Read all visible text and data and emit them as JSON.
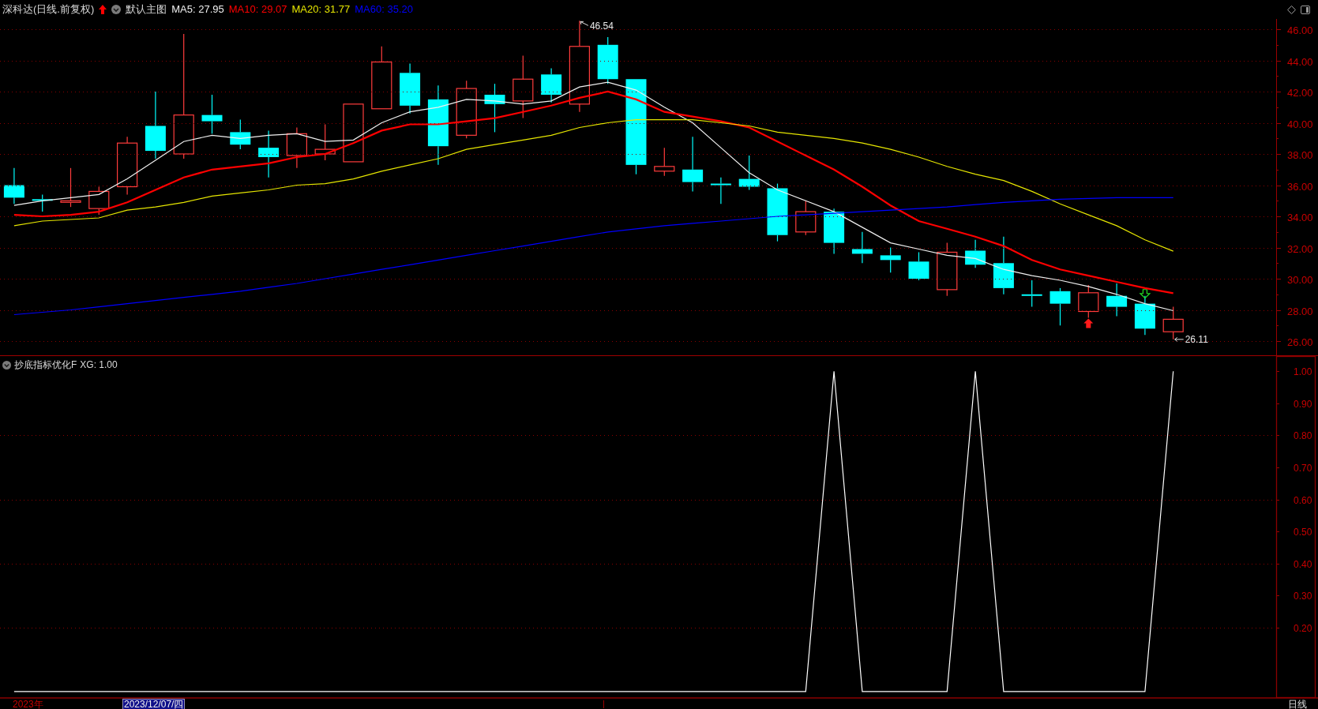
{
  "header": {
    "title": "深科达(日线.前复权)",
    "template": "默认主图",
    "readings": [
      ": 27.95",
      ": 29.07",
      ": 31.77",
      ": 35.20"
    ]
  },
  "main_chart": {
    "chart_data": {
      "type": "line",
      "grid": true,
      "ylim": [
        25.09,
        46.66
      ],
      "yticks": [
        {
          "value": 46,
          "label": "46.00"
        },
        {
          "value": 44,
          "label": "44.00"
        },
        {
          "value": 42,
          "label": "42.00"
        },
        {
          "value": 40,
          "label": "40.00"
        },
        {
          "value": 38,
          "label": "38.00"
        },
        {
          "value": 36,
          "label": "36.00"
        },
        {
          "value": 34,
          "label": "34.00"
        },
        {
          "value": 32,
          "label": "32.00"
        },
        {
          "value": 30,
          "label": "30.00"
        },
        {
          "value": 28,
          "label": "28.00"
        },
        {
          "value": 26,
          "label": "26.00"
        }
      ],
      "series": [
        {
          "name": "MA5",
          "color": "#f0f0f0",
          "values": [
            34.7,
            35.0,
            35.2,
            35.4,
            36.4,
            37.6,
            38.8,
            39.2,
            39.0,
            39.2,
            39.3,
            38.8,
            38.9,
            40.0,
            40.7,
            41.0,
            41.5,
            41.4,
            41.2,
            41.4,
            42.3,
            42.6,
            42.1,
            41.0,
            40.0,
            38.4,
            36.8,
            35.7,
            35.0,
            34.3,
            33.3,
            32.3,
            31.9,
            31.5,
            31.3,
            30.6,
            30.2,
            29.9,
            29.5,
            29.0,
            28.4,
            27.95,
            null,
            null,
            null
          ]
        },
        {
          "name": "MA10",
          "color": "#ff0000",
          "values": [
            34.1,
            34.0,
            34.1,
            34.3,
            34.9,
            35.7,
            36.5,
            37.0,
            37.2,
            37.4,
            37.8,
            38.0,
            38.7,
            39.5,
            39.9,
            39.9,
            40.1,
            40.3,
            40.7,
            41.1,
            41.6,
            42.0,
            41.5,
            40.7,
            40.4,
            40.1,
            39.7,
            38.8,
            37.9,
            37.0,
            35.9,
            34.7,
            33.7,
            33.2,
            32.7,
            32.1,
            31.2,
            30.6,
            30.2,
            29.8,
            29.4,
            29.07,
            null,
            null,
            null
          ]
        },
        {
          "name": "MA20",
          "color": "#e6e600",
          "values": [
            33.4,
            33.7,
            33.8,
            33.9,
            34.4,
            34.6,
            34.9,
            35.3,
            35.5,
            35.7,
            36.0,
            36.1,
            36.4,
            36.9,
            37.3,
            37.7,
            38.3,
            38.6,
            38.9,
            39.2,
            39.7,
            40.0,
            40.2,
            40.2,
            40.2,
            40.0,
            39.8,
            39.4,
            39.2,
            39.0,
            38.7,
            38.3,
            37.8,
            37.2,
            36.7,
            36.3,
            35.6,
            34.8,
            34.1,
            33.4,
            32.5,
            31.77,
            null,
            null,
            null
          ]
        },
        {
          "name": "MA60",
          "color": "#0000ff",
          "values": [
            27.7,
            27.85,
            28.0,
            28.2,
            28.4,
            28.6,
            28.8,
            29.0,
            29.2,
            29.45,
            29.7,
            30.0,
            30.3,
            30.6,
            30.9,
            31.2,
            31.5,
            31.8,
            32.1,
            32.4,
            32.7,
            33.0,
            33.2,
            33.4,
            33.55,
            33.7,
            33.85,
            34.0,
            34.1,
            34.2,
            34.3,
            34.4,
            34.5,
            34.6,
            34.75,
            34.9,
            35.0,
            35.1,
            35.15,
            35.2,
            35.2,
            35.2,
            null,
            null,
            null
          ]
        }
      ],
      "annotations": [
        "46.54",
        "26.11"
      ]
    }
  },
  "indicator_panel": {
    "reading": ": 1.00",
    "chart_data": {
      "type": "line",
      "title": "抄底指标优化F",
      "grid": true,
      "ylim": [
        -0.02,
        1.05
      ],
      "yticks": [
        {
          "value": 1.0,
          "label": "1.00"
        },
        {
          "value": 0.9,
          "label": "0.90"
        },
        {
          "value": 0.8,
          "label": "0.80"
        },
        {
          "value": 0.7,
          "label": "0.70"
        },
        {
          "value": 0.6,
          "label": "0.60"
        },
        {
          "value": 0.5,
          "label": "0.50"
        },
        {
          "value": 0.4,
          "label": "0.40"
        },
        {
          "value": 0.3,
          "label": "0.30"
        },
        {
          "value": 0.2,
          "label": "0.20"
        }
      ],
      "series": [
        {
          "name": "XG",
          "color": "#ffffff",
          "values": [
            0,
            0,
            0,
            0,
            0,
            0,
            0,
            0,
            0,
            0,
            0,
            0,
            0,
            0,
            0,
            0,
            0,
            0,
            0,
            0,
            0,
            0,
            0,
            0,
            0,
            0,
            0,
            0,
            0,
            1,
            0,
            0,
            0,
            0,
            1,
            0,
            0,
            0,
            0,
            0,
            0,
            1,
            null,
            null,
            null
          ]
        }
      ]
    }
  },
  "time_axis": {
    "year_label": "2023年",
    "cursor_date": "2023/12/07/四",
    "period": "日线"
  }
}
